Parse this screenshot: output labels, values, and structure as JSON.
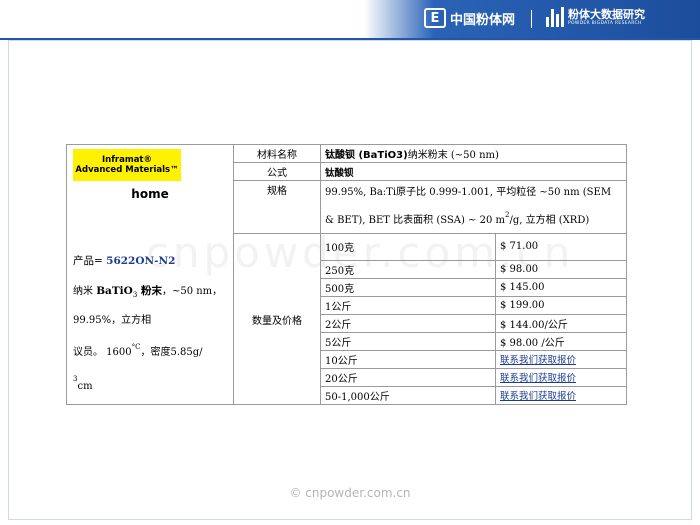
{
  "header": {
    "logo1_mark": "E",
    "logo1_text": "中国粉体网",
    "logo2_text": "粉体大数据研究",
    "logo2_sub": "POWDER BIGDATA RESEARCH",
    "colors": {
      "bar": "#1f58aa"
    }
  },
  "brand": {
    "line1": "Inframat®",
    "line2": "Advanced Materials™",
    "home": "home"
  },
  "product": {
    "code_label": "产品= ",
    "code": "5622ON-N2",
    "desc_pre": "纳米 ",
    "desc_formula_a": "BaTiO",
    "desc_formula_sub": "3",
    "desc_post": " 粉末，~50 nm，99.95%，立方相",
    "desc_line2_a": "议员。 1600",
    "desc_line2_deg": "°C",
    "desc_line2_b": "，密度5.85g/",
    "desc_line3_sub": "3",
    "desc_line3": "cm"
  },
  "table": {
    "name_label": "材料名称",
    "name_bold": "钛酸钡 (BaTiO3)",
    "name_rest": "纳米粉末 (~50 nm)",
    "formula_label": "公式",
    "formula_value": "钛酸钡",
    "spec_label": "规格",
    "spec_line1": "99.95%, Ba:Ti原子比 0.999-1.001, 平均粒径 ~50 nm (SEM",
    "spec_line2a": "& BET), BET 比表面积 (SSA) ~ 20 m",
    "spec_sup": "2",
    "spec_line2b": "/g, 立方相 (XRD)",
    "price_label": "数量及价格",
    "rows": [
      {
        "qty": "100克",
        "price": "$ 71.00"
      },
      {
        "qty": "250克",
        "price": "$ 98.00"
      },
      {
        "qty": "500克",
        "price": "$ 145.00"
      },
      {
        "qty": "1公斤",
        "price": "$ 199.00"
      },
      {
        "qty": "2公斤",
        "price": "$ 144.00/公斤"
      },
      {
        "qty": "5公斤",
        "price": "$ 98.00 /公斤"
      },
      {
        "qty": "10公斤",
        "price": "联系我们获取报价"
      },
      {
        "qty": "20公斤",
        "price": "联系我们获取报价"
      },
      {
        "qty": "50-1,000公斤",
        "price": "联系我们获取报价"
      }
    ]
  },
  "watermark": "cnpowder.com.cn",
  "footer": "©  cnpowder.com.cn"
}
